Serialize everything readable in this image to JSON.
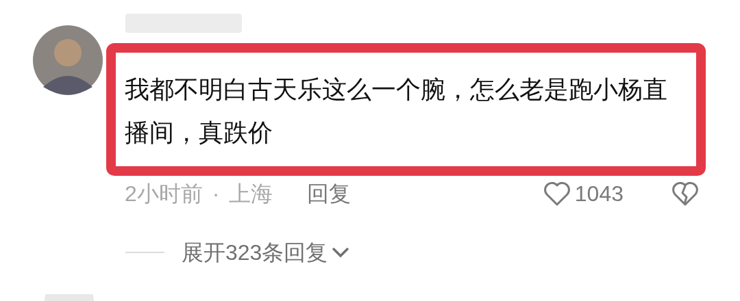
{
  "comment": {
    "text": "我都不明白古天乐这么一个腕，怎么老是跑小杨直播间，真跌价",
    "highlighted": true,
    "time": "2小时前",
    "separator": "·",
    "location": "上海",
    "reply": "回复",
    "likes": "1043",
    "expand_replies": "展开323条回复"
  }
}
